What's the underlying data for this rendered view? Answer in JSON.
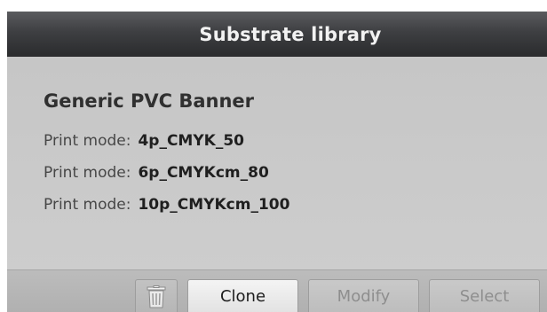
{
  "window": {
    "title": "Substrate library"
  },
  "substrate": {
    "name": "Generic PVC Banner",
    "print_modes": [
      {
        "label": "Print mode:",
        "value": "4p_CMYK_50"
      },
      {
        "label": "Print mode:",
        "value": "6p_CMYKcm_80"
      },
      {
        "label": "Print mode:",
        "value": "10p_CMYKcm_100"
      }
    ]
  },
  "toolbar": {
    "delete_icon": "trash-icon",
    "clone_label": "Clone",
    "modify_label": "Modify",
    "select_label": "Select"
  },
  "colors": {
    "titlebar": "#3e3f42",
    "background": "#c8c8c8",
    "active_button": "#f4f4f4",
    "disabled_text": "#8e8e8e"
  }
}
